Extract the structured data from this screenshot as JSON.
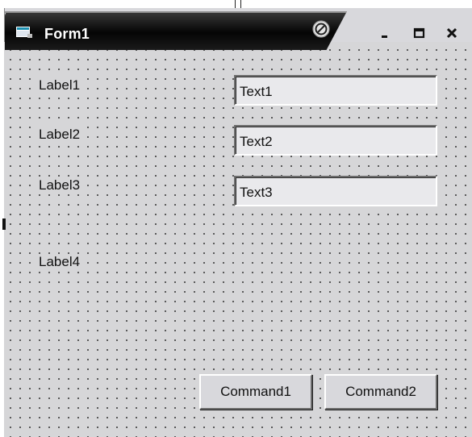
{
  "window": {
    "title": "Form1",
    "icons": {
      "app": "form-icon",
      "help": "whats-this-icon",
      "minimize": "minimize-icon",
      "maximize": "maximize-icon",
      "close": "close-icon"
    }
  },
  "labels": [
    {
      "text": "Label1"
    },
    {
      "text": "Label2"
    },
    {
      "text": "Label3"
    },
    {
      "text": "Label4"
    }
  ],
  "textboxes": [
    {
      "value": "Text1"
    },
    {
      "value": "Text2"
    },
    {
      "value": "Text3"
    }
  ],
  "buttons": [
    {
      "label": "Command1"
    },
    {
      "label": "Command2"
    }
  ],
  "colors": {
    "title_bar": "#050505",
    "form_background": "#d6d6d8",
    "grid_dots": "#3a3a3a"
  }
}
